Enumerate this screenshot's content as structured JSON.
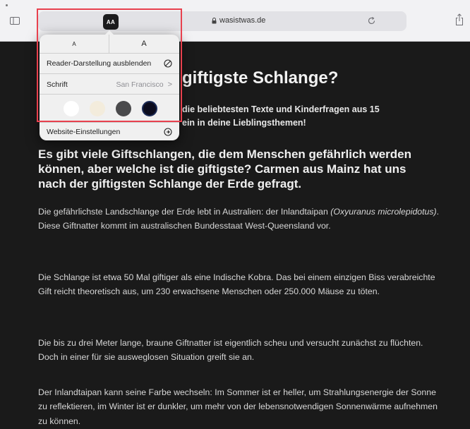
{
  "toolbar": {
    "aa_label": "AA",
    "url": "wasistwas.de"
  },
  "popover": {
    "font_small": "A",
    "font_large": "A",
    "reader_label": "Reader-Darstellung ausblenden",
    "font_label": "Schrift",
    "font_value": "San Francisco",
    "font_chevron": ">",
    "themes": [
      {
        "name": "white",
        "color": "#ffffff"
      },
      {
        "name": "sepia",
        "color": "#f3ecdc"
      },
      {
        "name": "gray",
        "color": "#4a4a4c"
      },
      {
        "name": "black",
        "color": "#0c0c1e"
      }
    ],
    "website_label": "Website-Einstellungen"
  },
  "article": {
    "title": "giftigste Schlange?",
    "intro_line1": "die beliebtesten Texte und Kinderfragen aus 15",
    "intro_line2": "ein in deine Lieblingsthemen!",
    "lead": "Es gibt viele Giftschlangen, die dem Menschen gefährlich werden können, aber welche ist die giftigste? Carmen aus Mainz hat uns nach der giftigsten Schlange der Erde gefragt.",
    "p1_before": "Die gefährlichste Landschlange der Erde lebt in Australien: der Inlandtaipan",
    "p1_sci": "(Oxyuranus microlepidotus)",
    "p1_after": ". Diese Giftnatter kommt im australischen Bundesstaat West-Queensland vor.",
    "p2": "Die Schlange ist etwa 50 Mal giftiger als eine Indische Kobra. Das bei einem einzigen Biss verabreichte Gift reicht theoretisch aus, um 230 erwachsene Menschen oder 250.000 Mäuse zu töten.",
    "p3": "Die bis zu drei Meter lange, braune Giftnatter ist eigentlich scheu und versucht zunächst zu flüchten. Doch in einer für sie ausweglosen Situation greift sie an.",
    "p4": "Der Inlandtaipan kann seine Farbe wechseln: Im Sommer ist er heller, um Strahlungsenergie der Sonne zu reflektieren, im Winter ist er dunkler, um mehr von der lebensnotwendigen Sonnenwärme aufnehmen zu können."
  },
  "colors": {
    "highlight": "#e8414e",
    "reader_background": "#1a1a1a"
  }
}
